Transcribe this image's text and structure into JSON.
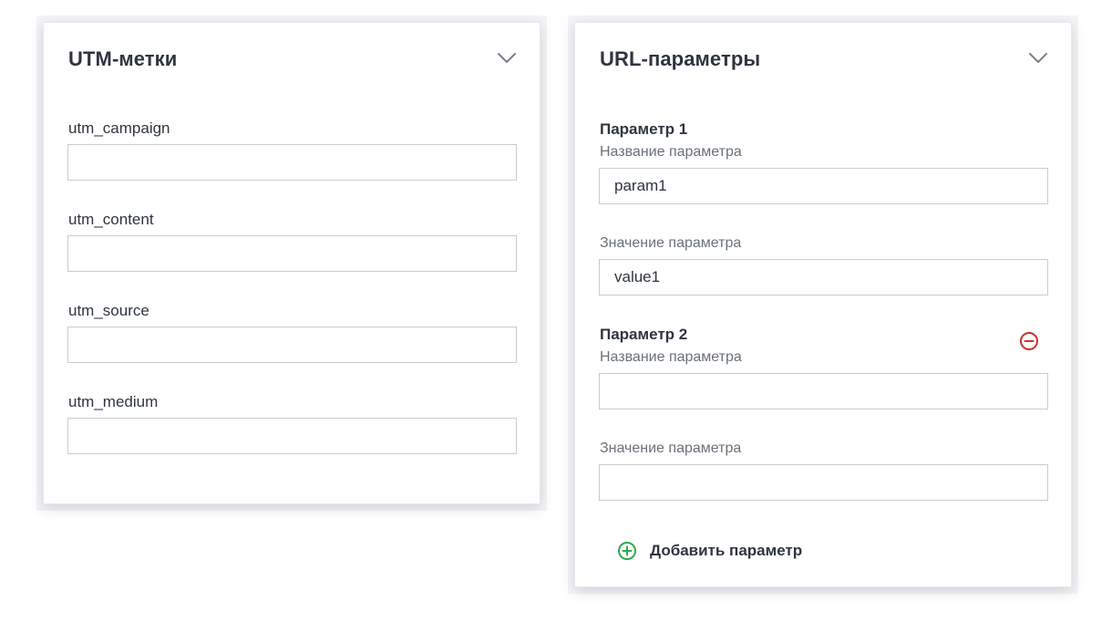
{
  "utm_card": {
    "title": "UTM-метки",
    "fields": [
      {
        "label": "utm_campaign",
        "value": ""
      },
      {
        "label": "utm_content",
        "value": ""
      },
      {
        "label": "utm_source",
        "value": ""
      },
      {
        "label": "utm_medium",
        "value": ""
      }
    ]
  },
  "url_card": {
    "title": "URL-параметры",
    "params": [
      {
        "title": "Параметр 1",
        "name_label": "Название параметра",
        "name_value": "param1",
        "value_label": "Значение параметра",
        "value_value": "value1"
      },
      {
        "title": "Параметр 2",
        "name_label": "Название параметра",
        "name_value": "",
        "value_label": "Значение параметра",
        "value_value": ""
      }
    ],
    "add_label": "Добавить параметр"
  },
  "icons": {
    "collapse": "chevron-down-icon",
    "remove": "minus-circle-icon",
    "add": "plus-circle-icon"
  },
  "colors": {
    "remove": "#d32f2f",
    "add": "#2eaa4f",
    "border": "#c9ccd1"
  }
}
